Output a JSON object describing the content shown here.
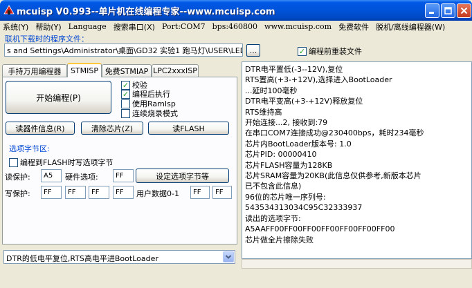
{
  "window": {
    "title": "mcuisp V0.993--单片机在线编程专家--www.mcuisp.com"
  },
  "menu": [
    {
      "label": "系统(Y)"
    },
    {
      "label": "帮助(Y)"
    },
    {
      "label": "Language"
    },
    {
      "label": "搜索串口(X)"
    },
    {
      "label": "Port:COM7"
    },
    {
      "label": "bps:460800"
    },
    {
      "label": "www.mcuisp.com"
    },
    {
      "label": "免费软件"
    },
    {
      "label": "脱机/离线编程器(W)"
    }
  ],
  "download": {
    "section_label": "联机下载时的程序文件：",
    "file_path": "s and Settings\\Administrator\\桌面\\GD32 实验1 跑马灯\\USER\\LED.hex",
    "browse_label": "...",
    "reload_label": "编程前重装文件",
    "reload_checked": true
  },
  "tabs": [
    {
      "label": "手持万用编程器"
    },
    {
      "label": "STMISP"
    },
    {
      "label": "免费STMIAP"
    },
    {
      "label": "LPC2xxxISP"
    }
  ],
  "stmisp": {
    "start_button": "开始编程(P)",
    "options": [
      {
        "label": "校验",
        "checked": true
      },
      {
        "label": "编程后执行",
        "checked": true
      },
      {
        "label": "使用RamIsp",
        "checked": false
      },
      {
        "label": "连续烧录模式",
        "checked": false
      }
    ],
    "read_info_button": "读器件信息(R)",
    "erase_button": "清除芯片(Z)",
    "read_flash_button": "读FLASH",
    "option_bytes": {
      "section_label": "选项字节区:",
      "write_option_label": "编程到FLASH时写选项字节",
      "write_option_checked": false,
      "read_protect_label": "读保护:",
      "read_protect_value": "A5",
      "hw_option_label": "硬件选项:",
      "hw_option_value": "FF",
      "set_button": "设定选项字节等",
      "write_protect_label": "写保护:",
      "write_protect_values": [
        "FF",
        "FF",
        "FF",
        "FF"
      ],
      "user_data_label": "用户数据0-1",
      "user_data_values": [
        "FF",
        "FF"
      ]
    }
  },
  "boot_mode": {
    "selected": "DTR的低电平复位,RTS高电平进BootLoader"
  },
  "log": [
    "DTR电平置低(-3--12V),复位",
    "RTS置高(+3-+12V),选择进入BootLoader",
    "...延时100毫秒",
    "DTR电平变高(+3-+12V)释放复位",
    "RTS维持高",
    "开始连接...2, 接收到:79",
    "在串口COM7连接成功@230400bps，耗时234毫秒",
    "芯片内BootLoader版本号: 1.0",
    "芯片PID: 00000410",
    "芯片FLASH容量为128KB",
    "芯片SRAM容量为20KB(此信息仅供参考,新版本芯片",
    "已不包含此信息)",
    "96位的芯片唯一序列号:",
    "543534313034C95C32333937",
    "读出的选项字节:",
    "A5AAFF00FF00FF00FF00FF00FF00FF00",
    "芯片做全片擦除失败"
  ],
  "colors": {
    "titlebar": "#0054e3",
    "window_bg": "#ece9d8",
    "section_label": "#0046d5",
    "check_mark": "#21a121"
  }
}
